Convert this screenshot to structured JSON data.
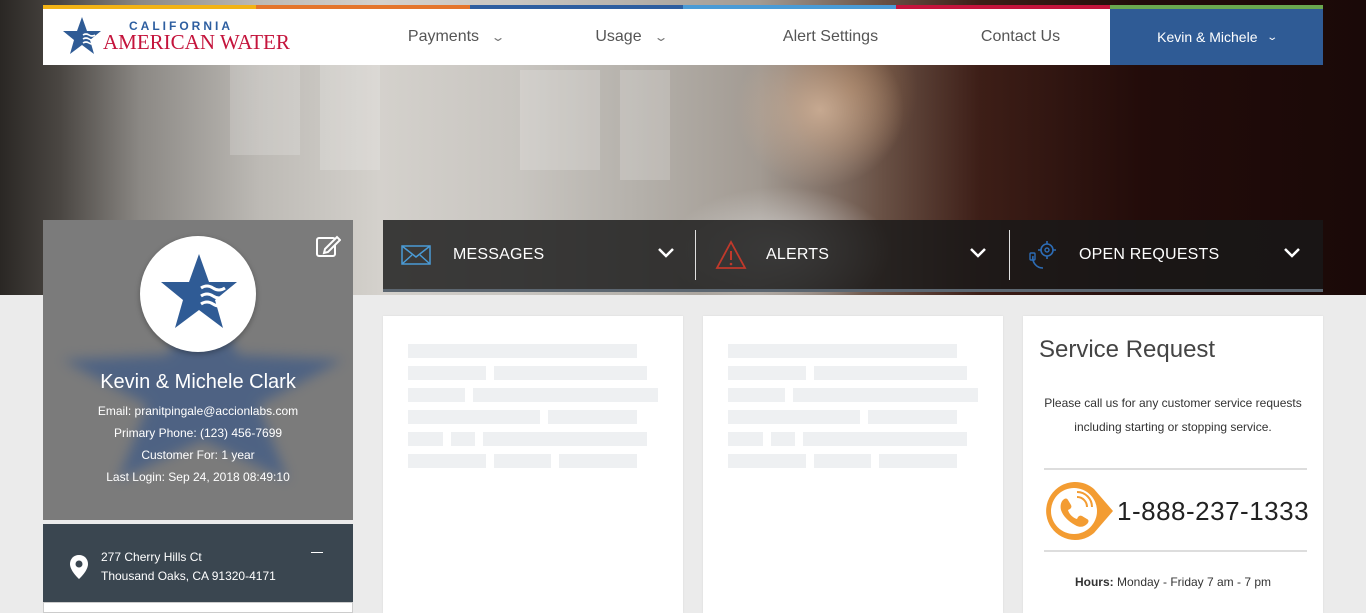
{
  "brand": {
    "line1": "CALIFORNIA",
    "line2": "AMERICAN WATER",
    "strip_colors": [
      "#f2b315",
      "#e4752b",
      "#2d5ea0",
      "#4a9bd6",
      "#c4143c",
      "#6aa84f"
    ]
  },
  "nav": {
    "payments": "Payments",
    "usage": "Usage",
    "alert_settings": "Alert Settings",
    "contact_us": "Contact Us",
    "user": "Kevin & Michele"
  },
  "profile": {
    "name": "Kevin & Michele Clark",
    "email": "Email: pranitpingale@accionlabs.com",
    "phone": "Primary Phone: (123) 456-7699",
    "customer_for": "Customer For: 1 year",
    "last_login": "Last Login: Sep 24, 2018 08:49:10"
  },
  "address": {
    "line1": "277 Cherry Hills Ct",
    "line2": "Thousand Oaks, CA 91320-4171"
  },
  "tabs": {
    "messages": "MESSAGES",
    "alerts": "ALERTS",
    "open_requests": "OPEN REQUESTS"
  },
  "service_request": {
    "title": "Service Request",
    "text1": "Please call us for any customer service requests",
    "text2": "including starting or stopping service.",
    "phone": "1-888-237-1333",
    "hours_label": "Hours:",
    "hours_value": " Monday - Friday 7 am - 7 pm"
  },
  "colors": {
    "brand_blue": "#2f5b95",
    "brand_red": "#c4143c",
    "phone_orange": "#f39c32",
    "alert_red": "#c0392b",
    "request_blue": "#2d6cb5"
  },
  "icons": [
    "edit-icon",
    "star-logo-icon",
    "location-pin-icon",
    "envelope-icon",
    "alert-triangle-icon",
    "gear-headset-icon",
    "phone-icon",
    "chevron-down-icon"
  ]
}
